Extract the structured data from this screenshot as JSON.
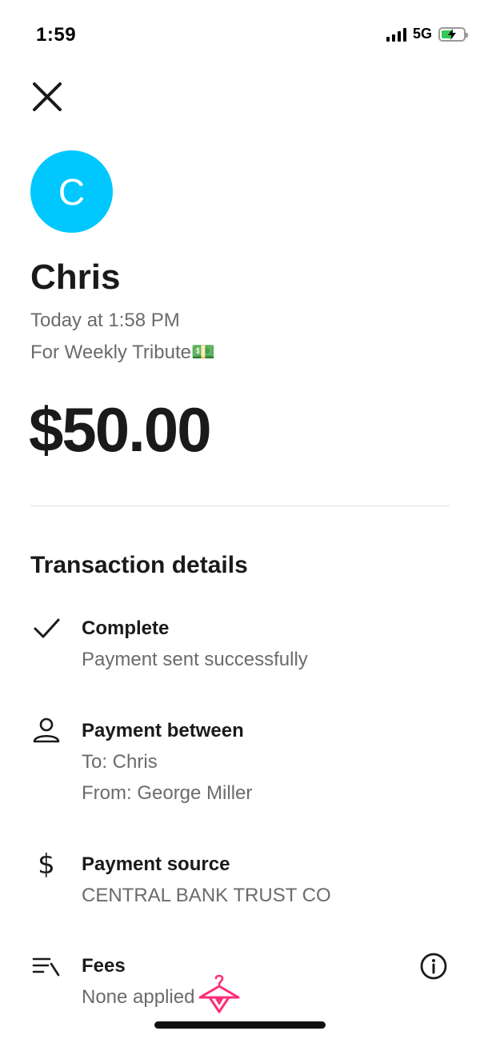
{
  "status_bar": {
    "time": "1:59",
    "network": "5G",
    "battery_level": 0.55,
    "signal_bars": 4
  },
  "header": {
    "close_icon": "close-icon"
  },
  "recipient": {
    "avatar_initial": "C",
    "avatar_color": "#00c8ff",
    "name": "Chris",
    "timestamp": "Today at 1:58 PM",
    "note": "For Weekly Tribute💵"
  },
  "payment": {
    "amount": "$50.00"
  },
  "details": {
    "title": "Transaction details",
    "status": {
      "icon": "checkmark-icon",
      "title": "Complete",
      "subtitle": "Payment sent successfully"
    },
    "parties": {
      "icon": "person-icon",
      "title": "Payment between",
      "to": "To: Chris",
      "from": "From: George Miller"
    },
    "source": {
      "icon": "dollar-icon",
      "title": "Payment source",
      "subtitle": "CENTRAL BANK TRUST CO"
    },
    "fees": {
      "icon": "fees-list-icon",
      "title": "Fees",
      "subtitle": "None applied",
      "info_icon": "info-icon"
    }
  }
}
